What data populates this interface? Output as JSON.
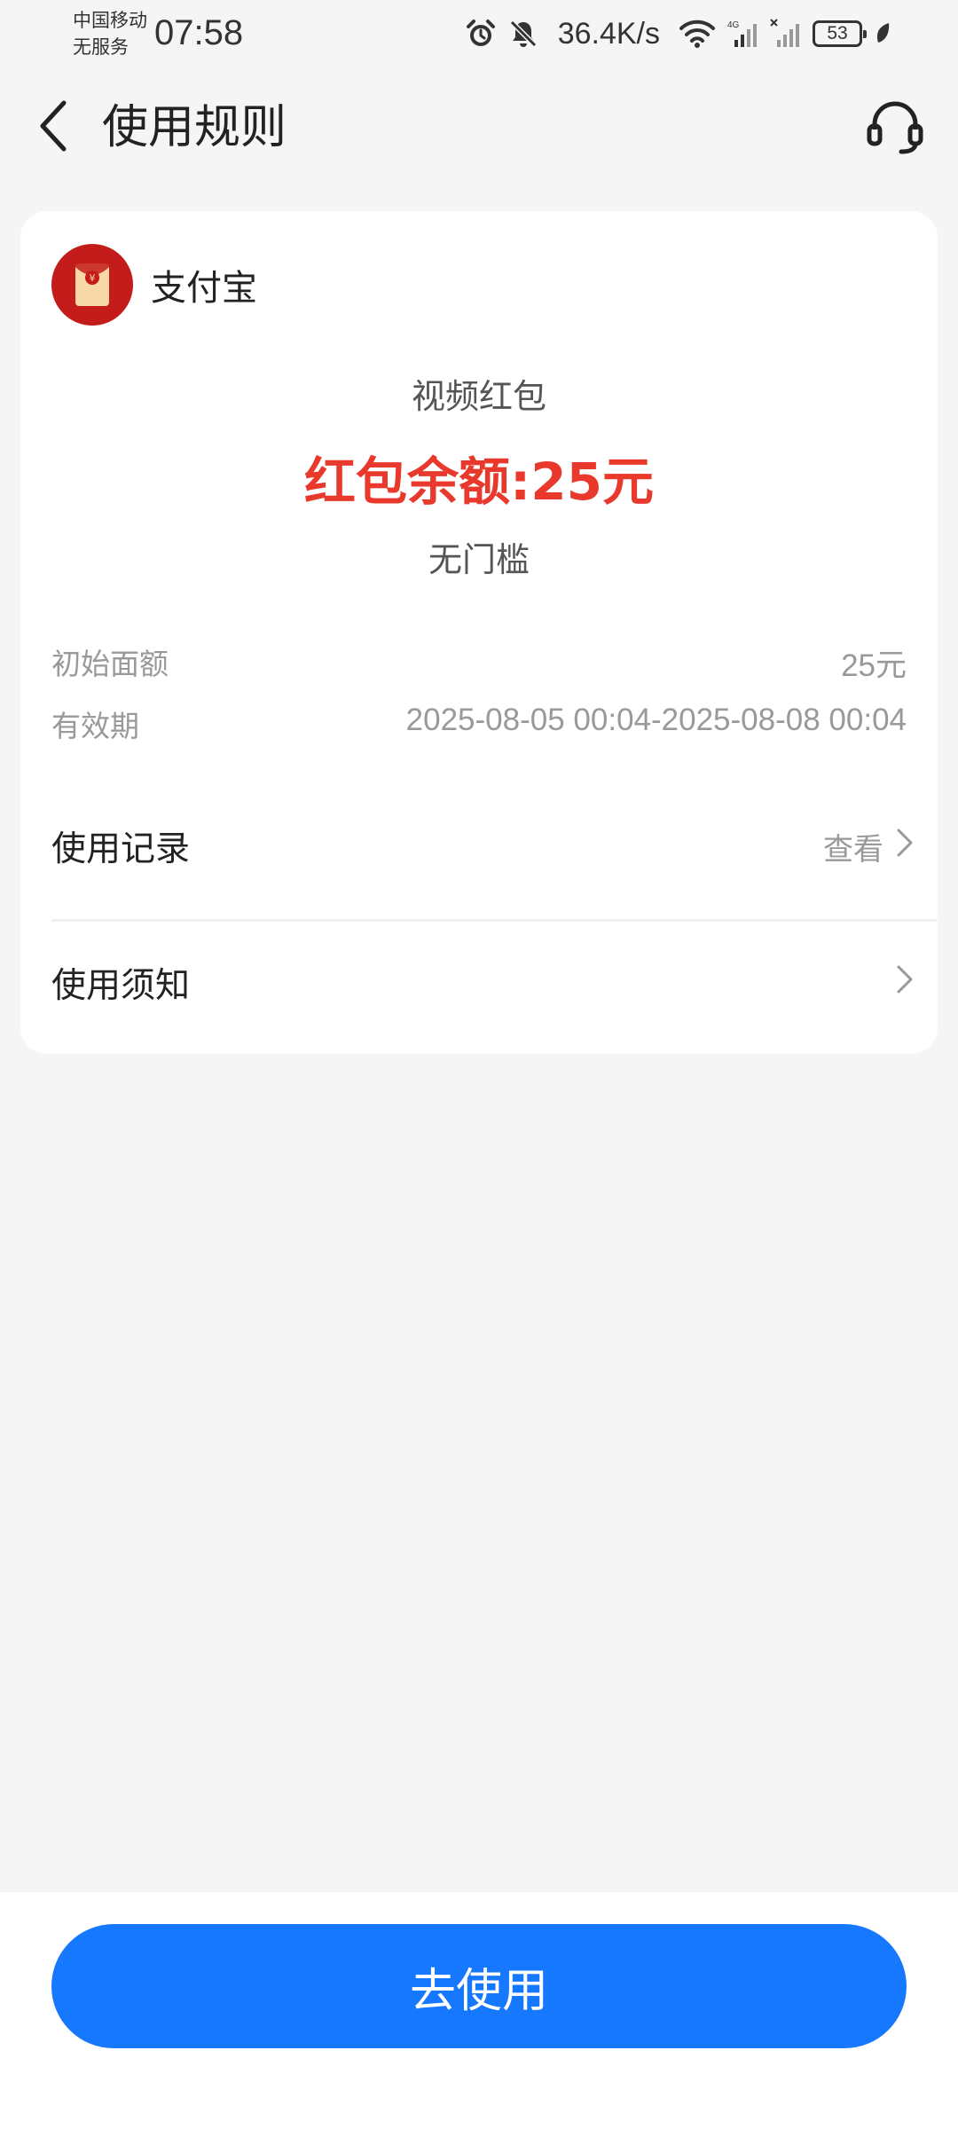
{
  "status_bar": {
    "carrier_line1": "中国移动",
    "carrier_line2": "无服务",
    "time": "07:58",
    "network_speed": "36.4K/s",
    "battery_level": "53",
    "network_type": "4G"
  },
  "header": {
    "title": "使用规则"
  },
  "merchant": {
    "name": "支付宝",
    "logo_color": "#c41b1b"
  },
  "coupon": {
    "type": "视频红包",
    "balance": "红包余额:25元",
    "threshold": "无门槛",
    "balance_color": "#e8392c"
  },
  "details": {
    "initial_label": "初始面额",
    "initial_value": "25元",
    "validity_label": "有效期",
    "validity_value": "2025-08-05 00:04-2025-08-08 00:04"
  },
  "links": {
    "records_label": "使用记录",
    "records_action": "查看",
    "notice_label": "使用须知"
  },
  "bottom": {
    "use_button_label": "去使用",
    "button_color": "#1677ff"
  }
}
